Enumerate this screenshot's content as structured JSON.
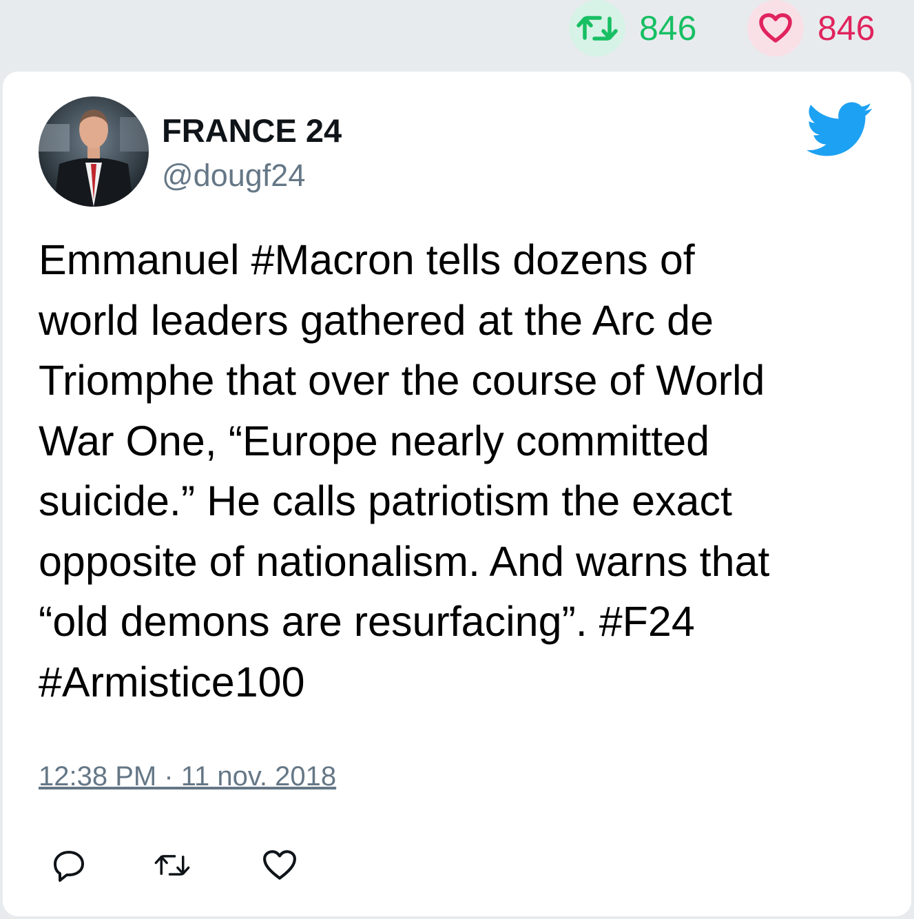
{
  "header": {
    "retweet_count": "846",
    "like_count": "846"
  },
  "tweet": {
    "author_name": "FRANCE 24",
    "author_handle": "@dougf24",
    "text": "Emmanuel #Macron tells dozens of\nworld leaders gathered at the Arc de\nTriomphe that over the course of World\nWar One, “Europe nearly committed\nsuicide.” He calls patriotism the exact\nopposite of nationalism. And warns that\n“old demons are resurfacing”. #F24\n#Armistice100",
    "timestamp": "12:38 PM · 11 nov. 2018"
  },
  "icons": {
    "retweet": "retweet-icon",
    "like": "heart-icon",
    "brand": "twitter-bird-icon",
    "reply": "reply-icon"
  },
  "colors": {
    "retweet_green": "#17bf63",
    "like_pink": "#e0245e",
    "twitter_blue": "#1da1f2",
    "muted_gray": "#657786"
  }
}
